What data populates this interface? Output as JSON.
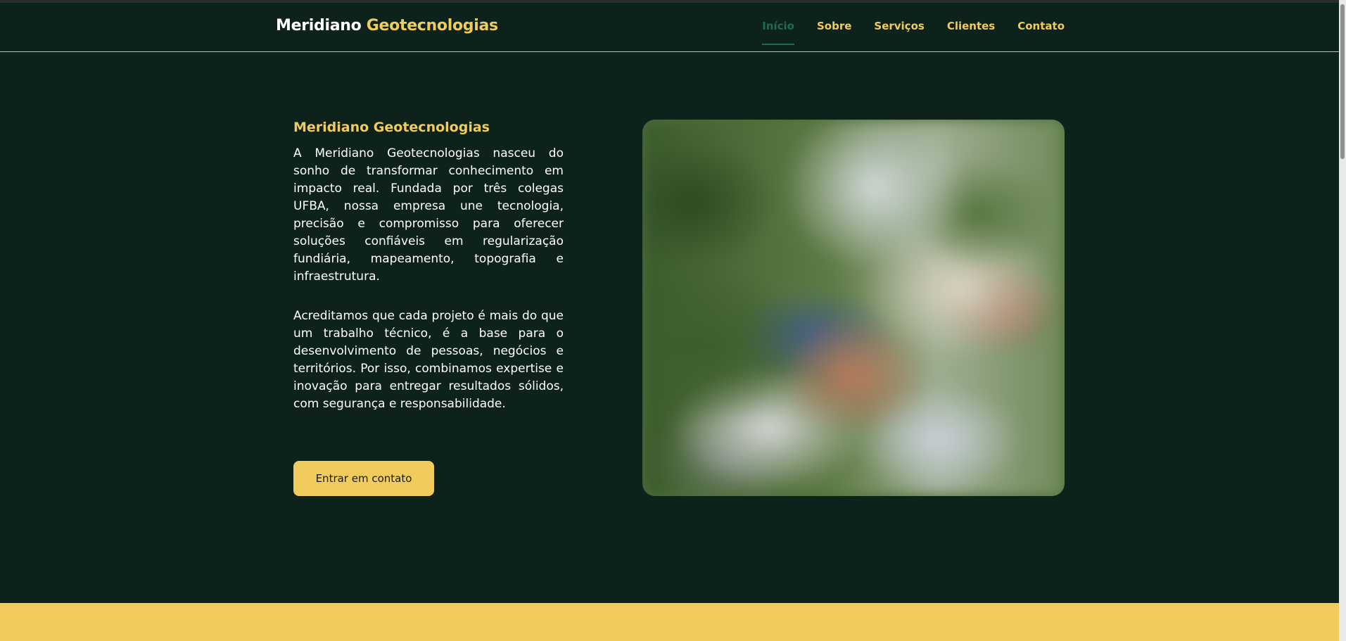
{
  "brand": {
    "name_white": "Meridiano",
    "name_yellow": "Geotecnologias"
  },
  "nav": {
    "items": [
      {
        "label": "Início",
        "active": true
      },
      {
        "label": "Sobre",
        "active": false
      },
      {
        "label": "Serviços",
        "active": false
      },
      {
        "label": "Clientes",
        "active": false
      },
      {
        "label": "Contato",
        "active": false
      }
    ]
  },
  "hero": {
    "title": "Meridiano Geotecnologias",
    "paragraphs": [
      "A Meridiano Geotecnologias nasceu do sonho de transformar conhecimento em impacto real. Fundada por três colegas UFBA, nossa empresa une tecnologia, precisão e compromisso para oferecer soluções confiáveis em regularização fundiária, mapeamento, topografia e infraestrutura.",
      "Acreditamos que cada projeto é mais do que um trabalho técnico, é a base para o desenvolvimento de pessoas, negócios e territórios. Por isso, combinamos expertise e inovação para entregar resultados sólidos, com segurança e responsabilidade."
    ],
    "cta_label": "Entrar em contato",
    "image_subject": "blurred-aerial-landscape-photo"
  },
  "colors": {
    "background": "#0e221c",
    "accent_yellow": "#f0cb5e",
    "active_nav": "#1f6b4a",
    "text_white": "#ffffff"
  }
}
